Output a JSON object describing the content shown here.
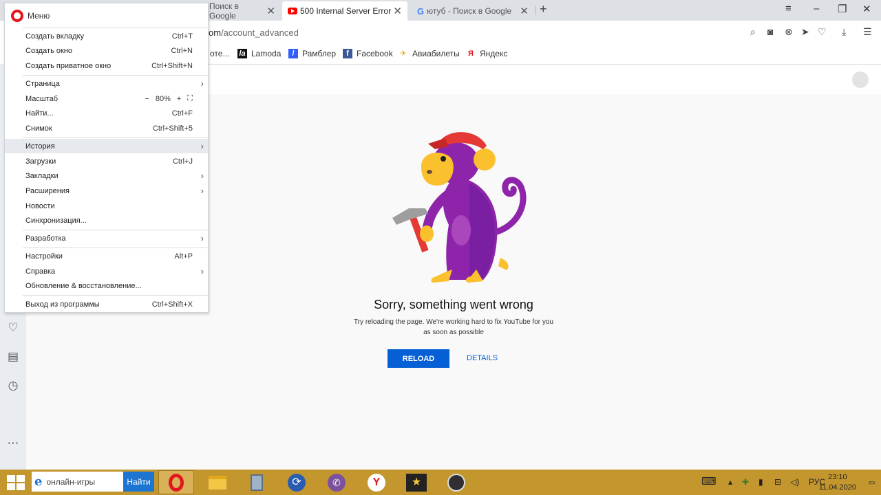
{
  "tabs": [
    {
      "title": "Поиск в Google",
      "icon": "none"
    },
    {
      "title": "500 Internal Server Error",
      "icon": "youtube-icon"
    },
    {
      "title": "ютуб - Поиск в Google",
      "icon": "google-icon"
    }
  ],
  "address": {
    "url_host": "om",
    "url_path": "/account_advanced"
  },
  "bookmarks": [
    {
      "label": "оте..."
    },
    {
      "label": "Lamoda",
      "icon_text": "la"
    },
    {
      "label": "Рамблер",
      "icon_text": "/"
    },
    {
      "label": "Facebook",
      "icon_text": "f"
    },
    {
      "label": "Авиабилеты",
      "icon_text": "✈"
    },
    {
      "label": "Яндекс",
      "icon_text": "Я"
    }
  ],
  "menu": {
    "title": "Меню",
    "items": [
      {
        "label": "Создать вкладку",
        "shortcut": "Ctrl+T"
      },
      {
        "label": "Создать окно",
        "shortcut": "Ctrl+N"
      },
      {
        "label": "Создать приватное окно",
        "shortcut": "Ctrl+Shift+N"
      },
      {
        "label": "Страница",
        "arrow": "›"
      },
      {
        "label": "Масштаб",
        "zoom_minus": "−",
        "zoom_value": "80%",
        "zoom_plus": "+",
        "zoom_fit": "⛶"
      },
      {
        "label": "Найти...",
        "shortcut": "Ctrl+F"
      },
      {
        "label": "Снимок",
        "shortcut": "Ctrl+Shift+5"
      },
      {
        "label": "История",
        "arrow": "›"
      },
      {
        "label": "Загрузки",
        "shortcut": "Ctrl+J"
      },
      {
        "label": "Закладки",
        "arrow": "›"
      },
      {
        "label": "Расширения",
        "arrow": "›"
      },
      {
        "label": "Новости"
      },
      {
        "label": "Синхронизация..."
      },
      {
        "label": "Разработка",
        "arrow": "›"
      },
      {
        "label": "Настройки",
        "shortcut": "Alt+P"
      },
      {
        "label": "Справка",
        "arrow": "›"
      },
      {
        "label": "Обновление & восстановление..."
      },
      {
        "label": "Выход из программы",
        "shortcut": "Ctrl+Shift+X"
      }
    ]
  },
  "error": {
    "title": "Sorry, something went wrong",
    "message": "Try reloading the page. We're working hard to fix YouTube for you as soon as possible",
    "reload_label": "RELOAD",
    "details_label": "DETAILS"
  },
  "taskbar": {
    "search_value": "онлайн-игры",
    "search_button": "Найти",
    "lang": "РУС",
    "time": "23:10",
    "date": "11.04.2020"
  },
  "colors": {
    "accent_blue": "#065fd4",
    "opera_red": "#e2161f",
    "taskbar": "#c3962e"
  }
}
